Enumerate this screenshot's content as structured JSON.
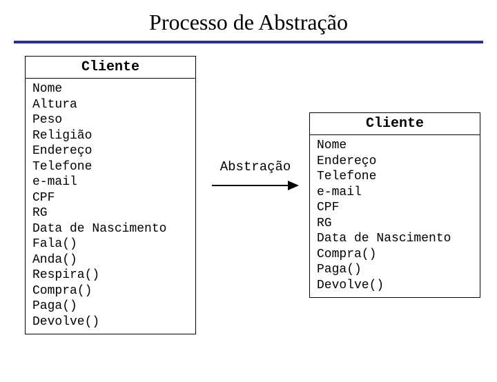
{
  "title": "Processo de Abstração",
  "arrow_label": "Abstração",
  "left_class": {
    "name": "Cliente",
    "members": "Nome\nAltura\nPeso\nReligião\nEndereço\nTelefone\ne-mail\nCPF\nRG\nData de Nascimento\nFala()\nAnda()\nRespira()\nCompra()\nPaga()\nDevolve()"
  },
  "right_class": {
    "name": "Cliente",
    "members": "Nome\nEndereço\nTelefone\ne-mail\nCPF\nRG\nData de Nascimento\nCompra()\nPaga()\nDevolve()"
  }
}
